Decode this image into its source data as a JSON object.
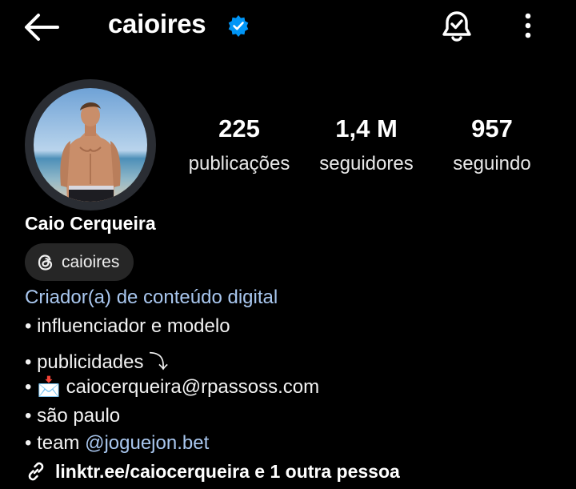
{
  "header": {
    "username": "caioires",
    "back_icon": "arrow-left-icon",
    "verified_icon": "verified-badge-icon",
    "verified_color": "#0095f6",
    "bell_icon": "notification-bell-icon",
    "more_icon": "more-vertical-icon"
  },
  "profile": {
    "avatar_icon": "profile-photo",
    "stats": [
      {
        "value": "225",
        "label": "publicações"
      },
      {
        "value": "1,4 M",
        "label": "seguidores"
      },
      {
        "value": "957",
        "label": "seguindo"
      }
    ],
    "full_name": "Caio Cerqueira",
    "threads": {
      "icon": "threads-icon",
      "label": "caioires"
    },
    "category": "Criador(a) de conteúdo digital",
    "bio": {
      "line1": "• influenciador e modelo",
      "line2": "• publicidades ⤵",
      "line3_prefix": "• ",
      "line3_emoji": "📩",
      "line3_text": "caiocerqueira@rpassoss.com",
      "line4": "• são paulo",
      "line5_prefix": "• team ",
      "line5_mention": "@joguejon.bet"
    },
    "link": {
      "icon": "link-icon",
      "label": "linktr.ee/caiocerqueira e 1 outra pessoa"
    },
    "accent_color": "#a9c7ef"
  }
}
